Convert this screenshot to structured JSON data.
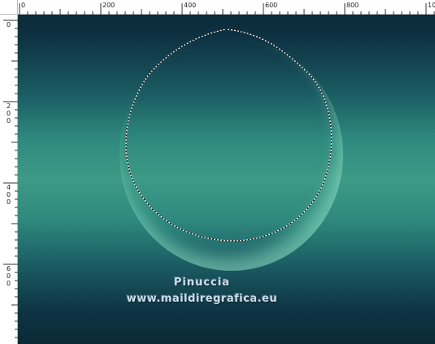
{
  "ruler": {
    "top_labels": [
      "0",
      "200",
      "400",
      "600",
      "800",
      "10"
    ],
    "left_labels": [
      [
        "0"
      ],
      [
        "2",
        "0",
        "0"
      ],
      [
        "4",
        "0",
        "0"
      ],
      [
        "6",
        "0",
        "0"
      ]
    ]
  },
  "canvas": {
    "colors": {
      "dark": "#0c2c39",
      "mid": "#1b5c63",
      "light": "#3d9a86",
      "watermark": "#c9ddea"
    }
  },
  "watermark": {
    "name": "Pinuccia",
    "url": "www.maildiregrafica.eu"
  }
}
